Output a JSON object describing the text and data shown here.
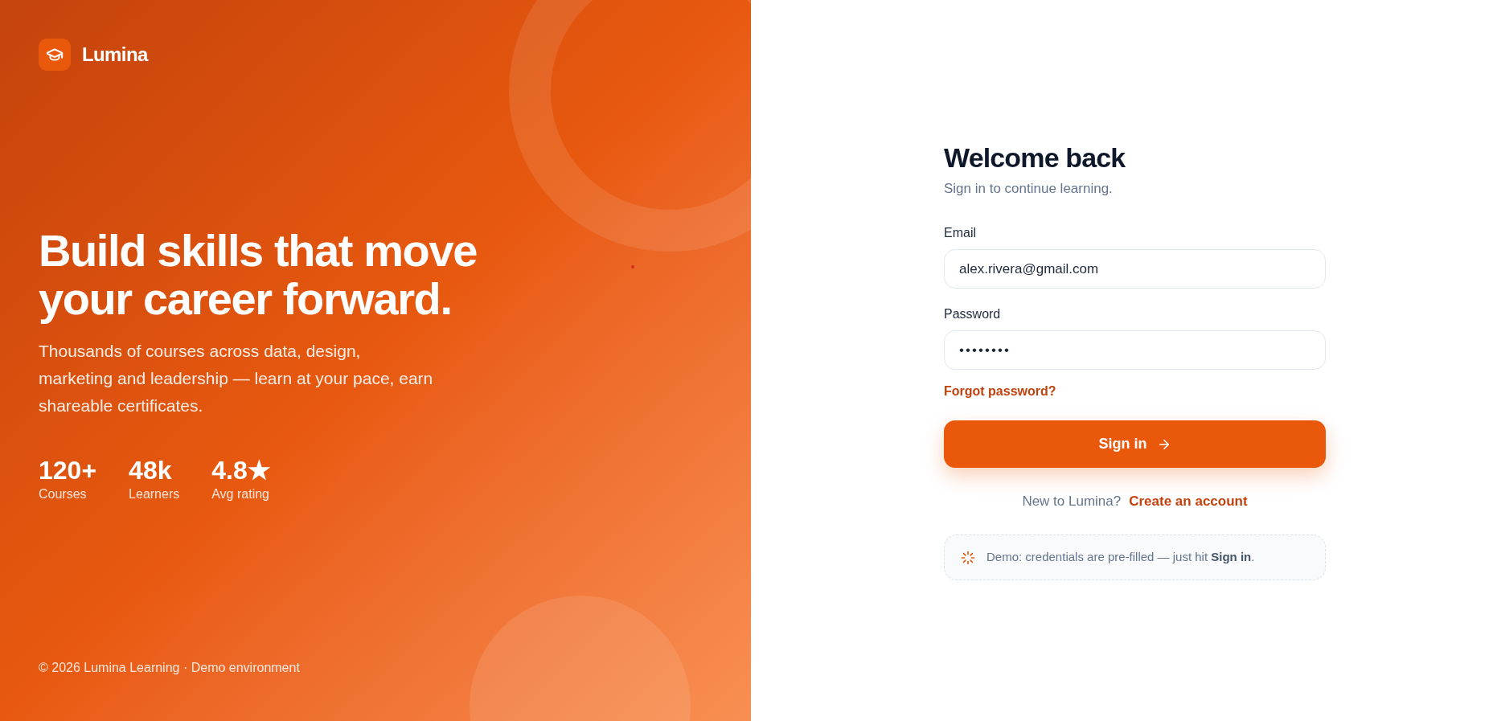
{
  "brand": {
    "name": "Lumina"
  },
  "hero": {
    "headline": "Build skills that move your career forward.",
    "description": "Thousands of courses across data, design, marketing and leadership — learn at your pace, earn shareable certificates.",
    "stats": [
      {
        "value": "120+",
        "label": "Courses"
      },
      {
        "value": "48k",
        "label": "Learners"
      },
      {
        "value": "4.8★",
        "label": "Avg rating"
      }
    ],
    "footer": "© 2026 Lumina Learning · Demo environment"
  },
  "form": {
    "title": "Welcome back",
    "subtitle": "Sign in to continue learning.",
    "fields": [
      {
        "label": "Email",
        "value": "alex.rivera@gmail.com"
      },
      {
        "label": "Password",
        "value": "••••••••"
      }
    ],
    "forgot_link": "Forgot password?",
    "submit": "Sign in",
    "signup": {
      "prompt": "New to Lumina?",
      "link": "Create an account"
    },
    "demo_note": "Demo: credentials are pre-filled — just hit **Sign in**."
  }
}
